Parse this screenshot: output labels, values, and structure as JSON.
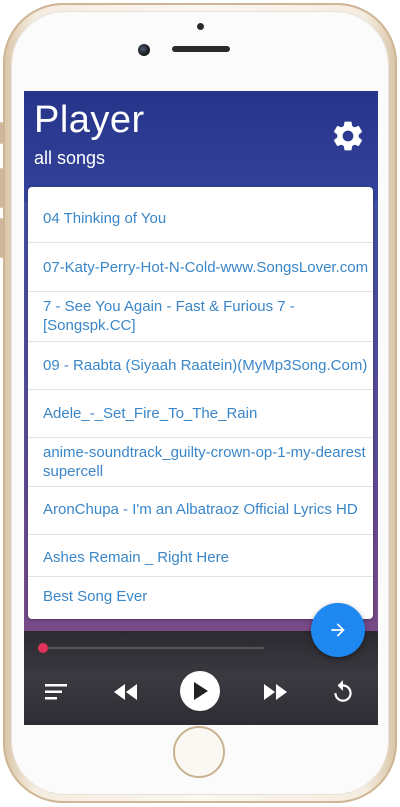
{
  "app": {
    "title": "Player",
    "subtitle": "all songs"
  },
  "songs": [
    {
      "label": "04 Thinking of You"
    },
    {
      "label": "07-Katy-Perry-Hot-N-Cold-www.SongsLover.com"
    },
    {
      "label": "7 - See You Again - Fast & Furious 7 -\n[Songspk.CC]"
    },
    {
      "label": "09 - Raabta (Siyaah Raatein)(MyMp3Song.Com)"
    },
    {
      "label": "Adele_-_Set_Fire_To_The_Rain"
    },
    {
      "label": "anime-soundtrack_guilty-crown-op-1-my-dearest\nsupercell"
    },
    {
      "label": "AronChupa - I'm an Albatraoz Official Lyrics HD"
    },
    {
      "label": "Ashes Remain _ Right Here"
    },
    {
      "label": "Best Song Ever"
    }
  ],
  "player": {
    "progress": 0.0
  },
  "icons": {
    "settings": "gear-icon",
    "fab": "arrow-right-icon",
    "playlist": "playlist-icon",
    "previous": "rewind-icon",
    "play": "play-icon",
    "next": "fast-forward-icon",
    "repeat": "repeat-icon"
  },
  "colors": {
    "header": "#26348a",
    "song_text": "#3a86c8",
    "fab": "#1e88f0",
    "progress": "#e0325a"
  }
}
